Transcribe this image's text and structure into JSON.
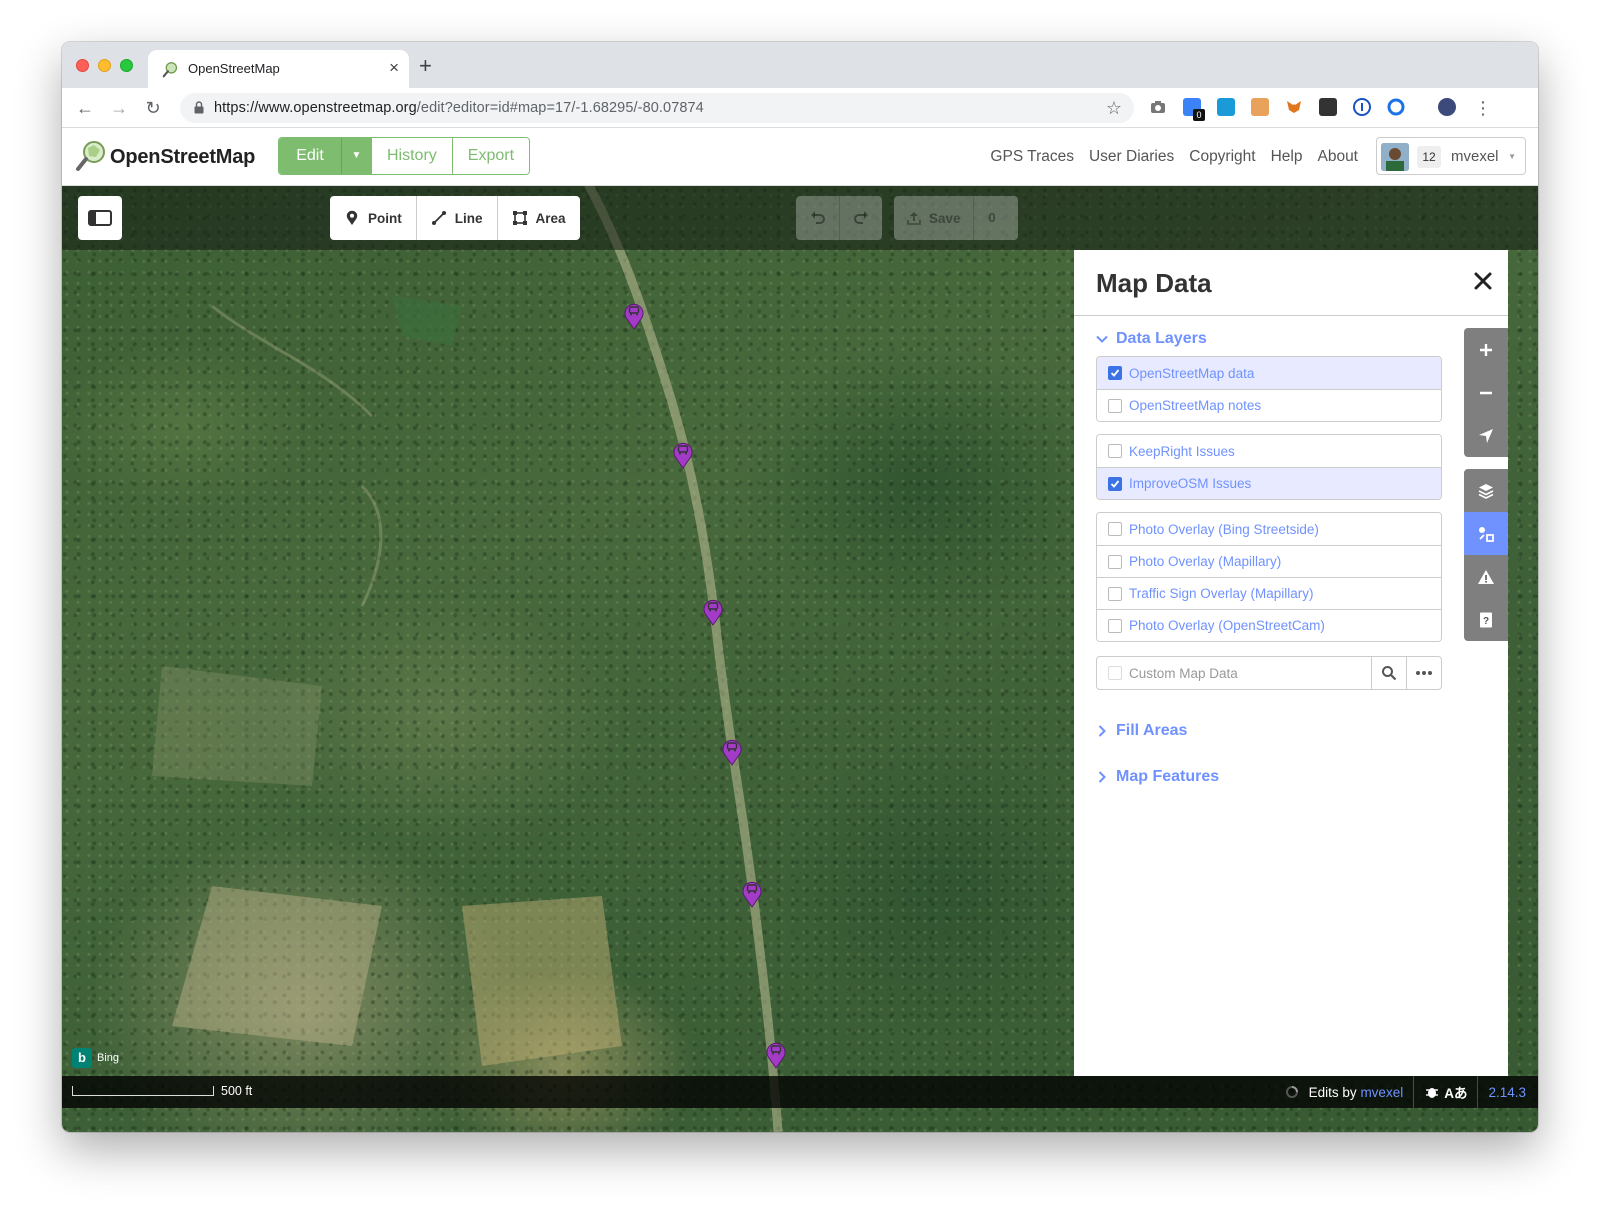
{
  "browser": {
    "tab_title": "OpenStreetMap",
    "tab_close": "×",
    "new_tab": "+",
    "url_host": "https://www.openstreetmap.org",
    "url_path": "/edit?editor=id#map=17/-1.68295/-80.07874",
    "nav_back": "←",
    "nav_forward": "→",
    "nav_reload": "↻",
    "bookmark_star": "☆",
    "menu_dots": "⋮",
    "extension_badge": "0"
  },
  "osm_header": {
    "brand": "OpenStreetMap",
    "edit_label": "Edit",
    "history_label": "History",
    "export_label": "Export",
    "nav": [
      "GPS Traces",
      "User Diaries",
      "Copyright",
      "Help",
      "About"
    ],
    "user_count": "12",
    "user_name": "mvexel",
    "accent": "#7ebc6f"
  },
  "editor": {
    "modes": {
      "point": "Point",
      "line": "Line",
      "area": "Area"
    },
    "save_label": "Save",
    "save_count": "0",
    "scale_label": "500 ft",
    "imagery_label": "Bing",
    "edits_by_prefix": "Edits by",
    "edits_by_user": "mvexel",
    "version": "2.14.3",
    "accessibility_glyph": "Aあ"
  },
  "map_data_pane": {
    "title": "Map Data",
    "data_layers_title": "Data Layers",
    "layer_groups": [
      [
        {
          "label": "OpenStreetMap data",
          "checked": true
        },
        {
          "label": "OpenStreetMap notes",
          "checked": false
        }
      ],
      [
        {
          "label": "KeepRight Issues",
          "checked": false
        },
        {
          "label": "ImproveOSM Issues",
          "checked": true
        }
      ],
      [
        {
          "label": "Photo Overlay (Bing Streetside)",
          "checked": false
        },
        {
          "label": "Photo Overlay (Mapillary)",
          "checked": false
        },
        {
          "label": "Traffic Sign Overlay (Mapillary)",
          "checked": false
        },
        {
          "label": "Photo Overlay (OpenStreetCam)",
          "checked": false
        }
      ]
    ],
    "custom_data_label": "Custom Map Data",
    "fill_areas_title": "Fill Areas",
    "map_features_title": "Map Features",
    "link_color": "#7092ff"
  },
  "map_controls": {
    "zoom_in": "zoom-in",
    "zoom_out": "zoom-out",
    "geolocate": "geolocate",
    "background": "background-layers",
    "map_data": "map-data",
    "issues": "issues",
    "help": "help",
    "active": "map-data"
  },
  "issue_marker_color": "#a23bc6"
}
